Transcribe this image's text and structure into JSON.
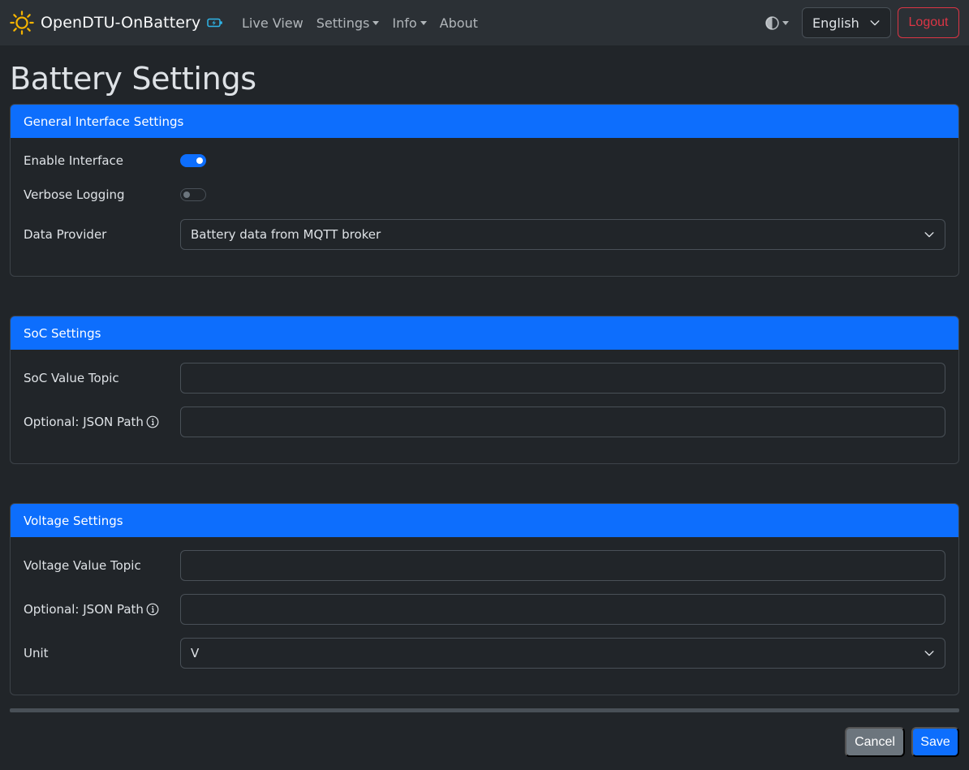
{
  "navbar": {
    "brand": "OpenDTU-OnBattery",
    "links": {
      "live_view": "Live View",
      "settings": "Settings",
      "info": "Info",
      "about": "About"
    },
    "language": "English",
    "logout": "Logout"
  },
  "page": {
    "title": "Battery Settings"
  },
  "general": {
    "header": "General Interface Settings",
    "enable_label": "Enable Interface",
    "enable_on": true,
    "verbose_label": "Verbose Logging",
    "verbose_on": false,
    "provider_label": "Data Provider",
    "provider_value": "Battery data from MQTT broker"
  },
  "soc": {
    "header": "SoC Settings",
    "topic_label": "SoC Value Topic",
    "topic_value": "",
    "json_label": "Optional: JSON Path",
    "json_value": ""
  },
  "voltage": {
    "header": "Voltage Settings",
    "topic_label": "Voltage Value Topic",
    "topic_value": "",
    "json_label": "Optional: JSON Path",
    "json_value": "",
    "unit_label": "Unit",
    "unit_value": "V"
  },
  "actions": {
    "cancel": "Cancel",
    "save": "Save"
  },
  "colors": {
    "primary": "#0d6efd",
    "danger": "#dc3545",
    "secondary": "#6c757d",
    "background": "#212529",
    "navbar": "#2b3035"
  }
}
